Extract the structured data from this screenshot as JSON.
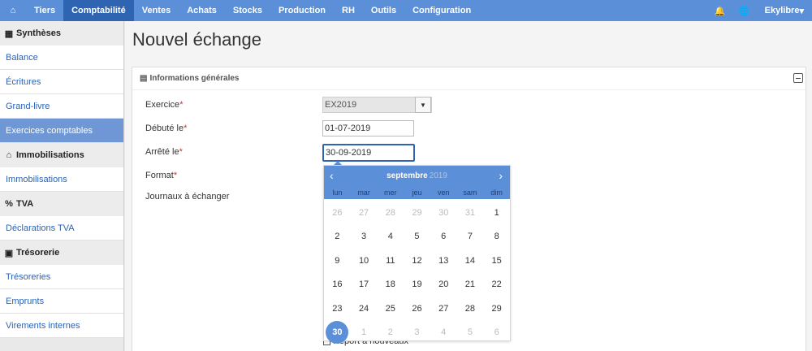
{
  "nav": {
    "items": [
      "Tiers",
      "Comptabilité",
      "Ventes",
      "Achats",
      "Stocks",
      "Production",
      "RH",
      "Outils",
      "Configuration"
    ],
    "active": "Comptabilité",
    "user": "Ekylibre",
    "user_caret": "▾",
    "home_icon": "⌂",
    "bell_icon": "🔔",
    "globe_icon": "🌐"
  },
  "sidebar": {
    "syntheses": {
      "title": "Synthèses",
      "icon": "▦",
      "items": [
        "Balance",
        "Écritures",
        "Grand-livre",
        "Exercices comptables"
      ]
    },
    "immobilisations": {
      "title": "Immobilisations",
      "icon": "⌂",
      "items": [
        "Immobilisations"
      ]
    },
    "tva": {
      "title": "TVA",
      "icon": "%",
      "items": [
        "Déclarations TVA"
      ]
    },
    "tresorerie": {
      "title": "Trésorerie",
      "icon": "▣",
      "items": [
        "Trésoreries",
        "Emprunts",
        "Virements internes"
      ]
    }
  },
  "page": {
    "title": "Nouvel échange",
    "panel_title": "Informations générales",
    "panel_icon": "▤"
  },
  "form": {
    "exercice_label": "Exercice",
    "exercice_value": "EX2019",
    "debut_label": "Débuté le",
    "debut_value": "01-07-2019",
    "arrete_label": "Arrêté le",
    "arrete_value": "30-09-2019",
    "format_label": "Format",
    "journaux_label": "Journaux à échanger",
    "required_mark": "*",
    "report_label": "Report à nouveaux"
  },
  "datepicker": {
    "month": "septembre",
    "year": "2019",
    "prev": "‹",
    "next": "›",
    "weekdays": [
      "lun",
      "mar",
      "mer",
      "jeu",
      "ven",
      "sam",
      "dim"
    ],
    "days": [
      {
        "d": "26",
        "m": true
      },
      {
        "d": "27",
        "m": true
      },
      {
        "d": "28",
        "m": true
      },
      {
        "d": "29",
        "m": true
      },
      {
        "d": "30",
        "m": true
      },
      {
        "d": "31",
        "m": true
      },
      {
        "d": "1",
        "m": false
      },
      {
        "d": "2",
        "m": false
      },
      {
        "d": "3",
        "m": false
      },
      {
        "d": "4",
        "m": false
      },
      {
        "d": "5",
        "m": false
      },
      {
        "d": "6",
        "m": false
      },
      {
        "d": "7",
        "m": false
      },
      {
        "d": "8",
        "m": false
      },
      {
        "d": "9",
        "m": false
      },
      {
        "d": "10",
        "m": false
      },
      {
        "d": "11",
        "m": false
      },
      {
        "d": "12",
        "m": false
      },
      {
        "d": "13",
        "m": false
      },
      {
        "d": "14",
        "m": false
      },
      {
        "d": "15",
        "m": false
      },
      {
        "d": "16",
        "m": false
      },
      {
        "d": "17",
        "m": false
      },
      {
        "d": "18",
        "m": false
      },
      {
        "d": "19",
        "m": false
      },
      {
        "d": "20",
        "m": false
      },
      {
        "d": "21",
        "m": false
      },
      {
        "d": "22",
        "m": false
      },
      {
        "d": "23",
        "m": false
      },
      {
        "d": "24",
        "m": false
      },
      {
        "d": "25",
        "m": false
      },
      {
        "d": "26",
        "m": false
      },
      {
        "d": "27",
        "m": false
      },
      {
        "d": "28",
        "m": false
      },
      {
        "d": "29",
        "m": false
      },
      {
        "d": "30",
        "m": false,
        "selected": true
      },
      {
        "d": "1",
        "m": true
      },
      {
        "d": "2",
        "m": true
      },
      {
        "d": "3",
        "m": true
      },
      {
        "d": "4",
        "m": true
      },
      {
        "d": "5",
        "m": true
      },
      {
        "d": "6",
        "m": true
      }
    ]
  },
  "colors": {
    "nav_bg": "#5b8fd8",
    "nav_active": "#2f64b3",
    "link": "#2b63b5",
    "sidebar_active": "#6f97d6"
  }
}
